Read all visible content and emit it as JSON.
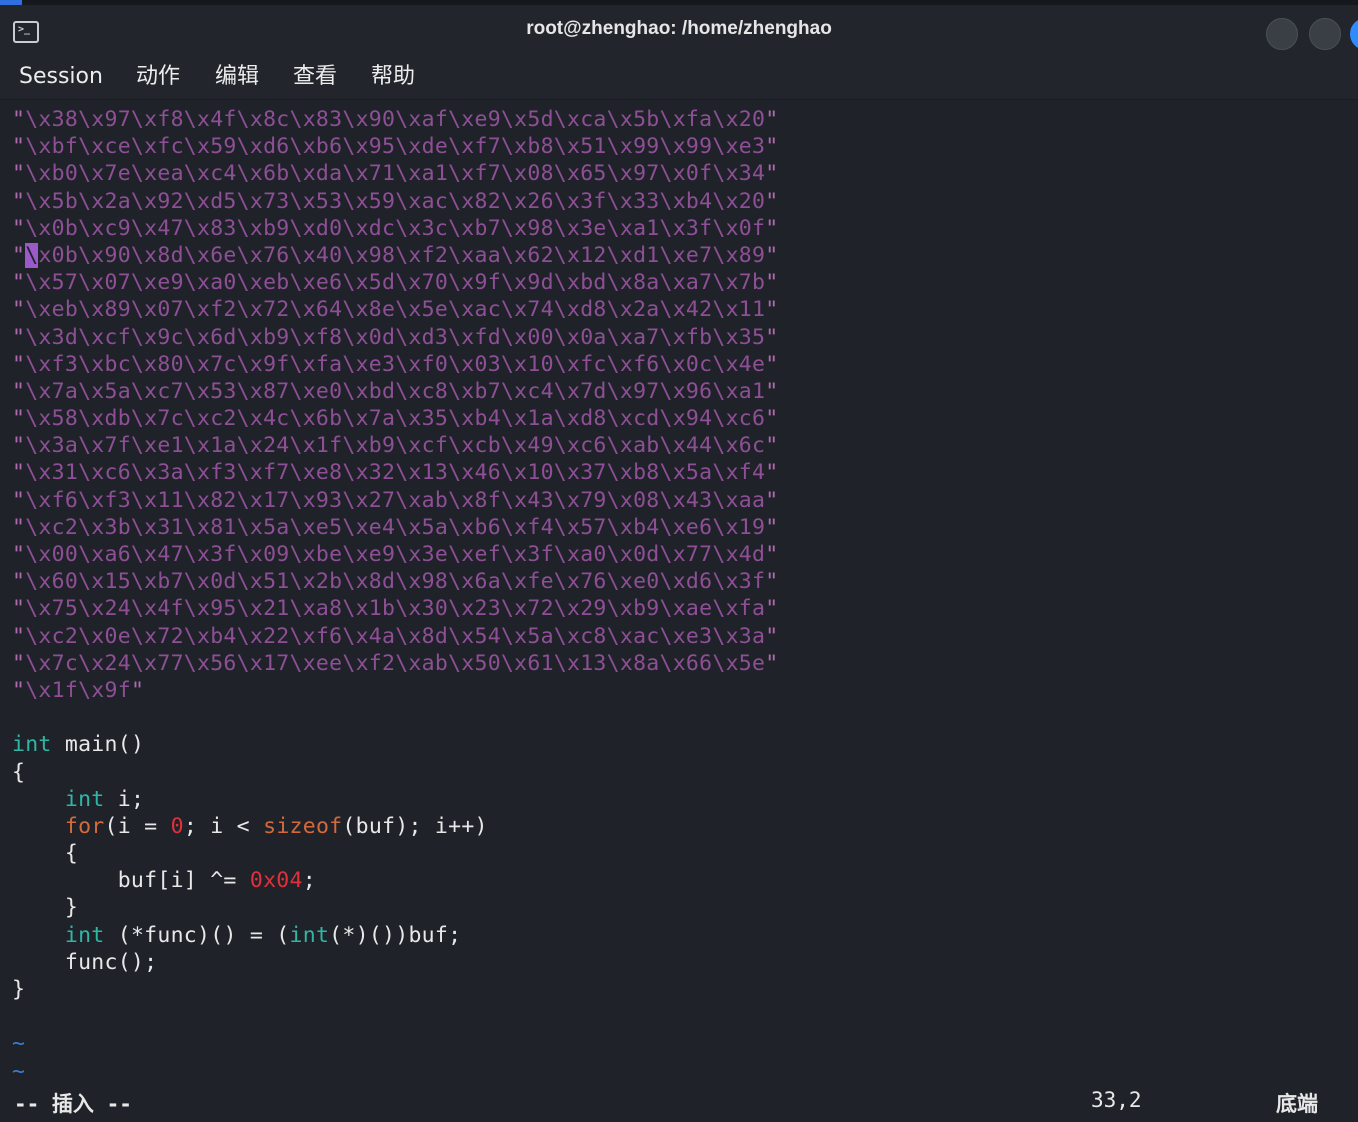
{
  "window": {
    "title": "root@zhenghao: /home/zhenghao"
  },
  "menu": [
    "Session",
    "动作",
    "编辑",
    "查看",
    "帮助"
  ],
  "hex_lines": [
    "\\x38\\x97\\xf8\\x4f\\x8c\\x83\\x90\\xaf\\xe9\\x5d\\xca\\x5b\\xfa\\x20",
    "\\xbf\\xce\\xfc\\x59\\xd6\\xb6\\x95\\xde\\xf7\\xb8\\x51\\x99\\x99\\xe3",
    "\\xb0\\x7e\\xea\\xc4\\x6b\\xda\\x71\\xa1\\xf7\\x08\\x65\\x97\\x0f\\x34",
    "\\x5b\\x2a\\x92\\xd5\\x73\\x53\\x59\\xac\\x82\\x26\\x3f\\x33\\xb4\\x20",
    "\\x0b\\xc9\\x47\\x83\\xb9\\xd0\\xdc\\x3c\\xb7\\x98\\x3e\\xa1\\x3f\\x0f",
    "\\x0b\\x90\\x8d\\x6e\\x76\\x40\\x98\\xf2\\xaa\\x62\\x12\\xd1\\xe7\\x89",
    "\\x57\\x07\\xe9\\xa0\\xeb\\xe6\\x5d\\x70\\x9f\\x9d\\xbd\\x8a\\xa7\\x7b",
    "\\xeb\\x89\\x07\\xf2\\x72\\x64\\x8e\\x5e\\xac\\x74\\xd8\\x2a\\x42\\x11",
    "\\x3d\\xcf\\x9c\\x6d\\xb9\\xf8\\x0d\\xd3\\xfd\\x00\\x0a\\xa7\\xfb\\x35",
    "\\xf3\\xbc\\x80\\x7c\\x9f\\xfa\\xe3\\xf0\\x03\\x10\\xfc\\xf6\\x0c\\x4e",
    "\\x7a\\x5a\\xc7\\x53\\x87\\xe0\\xbd\\xc8\\xb7\\xc4\\x7d\\x97\\x96\\xa1",
    "\\x58\\xdb\\x7c\\xc2\\x4c\\x6b\\x7a\\x35\\xb4\\x1a\\xd8\\xcd\\x94\\xc6",
    "\\x3a\\x7f\\xe1\\x1a\\x24\\x1f\\xb9\\xcf\\xcb\\x49\\xc6\\xab\\x44\\x6c",
    "\\x31\\xc6\\x3a\\xf3\\xf7\\xe8\\x32\\x13\\x46\\x10\\x37\\xb8\\x5a\\xf4",
    "\\xf6\\xf3\\x11\\x82\\x17\\x93\\x27\\xab\\x8f\\x43\\x79\\x08\\x43\\xaa",
    "\\xc2\\x3b\\x31\\x81\\x5a\\xe5\\xe4\\x5a\\xb6\\xf4\\x57\\xb4\\xe6\\x19",
    "\\x00\\xa6\\x47\\x3f\\x09\\xbe\\xe9\\x3e\\xef\\x3f\\xa0\\x0d\\x77\\x4d",
    "\\x60\\x15\\xb7\\x0d\\x51\\x2b\\x8d\\x98\\x6a\\xfe\\x76\\xe0\\xd6\\x3f",
    "\\x75\\x24\\x4f\\x95\\x21\\xa8\\x1b\\x30\\x23\\x72\\x29\\xb9\\xae\\xfa",
    "\\xc2\\x0e\\x72\\xb4\\x22\\xf6\\x4a\\x8d\\x54\\x5a\\xc8\\xac\\xe3\\x3a",
    "\\x7c\\x24\\x77\\x56\\x17\\xee\\xf2\\xab\\x50\\x61\\x13\\x8a\\x66\\x5e",
    "\\x1f\\x9f"
  ],
  "code": {
    "int_kw": "int",
    "main_sig": " main()",
    "open_brace": "{",
    "close_brace": "}",
    "indent": "    ",
    "indent2": "        ",
    "decl_rest": " i;",
    "for_kw": "for",
    "for_a": "(i = ",
    "zero": "0",
    "for_b": "; i < ",
    "sizeof_kw": "sizeof",
    "for_c": "(buf); i++)",
    "xor_a": "buf[i] ^= ",
    "hex_const": "0x04",
    "semicolon": ";",
    "func_a": " (*func)() = (",
    "func_b": "(*)())buf;",
    "call": "func();",
    "tilde": "~"
  },
  "status": {
    "mode": "-- 插入 --",
    "position": "33,2",
    "scroll": "底端"
  }
}
